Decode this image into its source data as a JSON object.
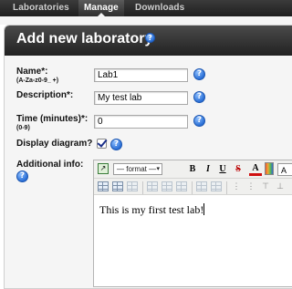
{
  "nav": {
    "tabs": [
      {
        "label": "Laboratories"
      },
      {
        "label": "Manage"
      },
      {
        "label": "Downloads"
      }
    ]
  },
  "panel": {
    "title": "Add new laboratory",
    "help_glyph": "?"
  },
  "form": {
    "name": {
      "label": "Name*:",
      "hint": "(A-Za-z0-9_ +)",
      "value": "Lab1"
    },
    "description": {
      "label": "Description*:",
      "value": "My test lab"
    },
    "time": {
      "label": "Time (minutes)*:",
      "hint": "(0-9)",
      "value": "0"
    },
    "display_diagram": {
      "label": "Display diagram?",
      "checked": true
    },
    "additional_info": {
      "label": "Additional info:"
    }
  },
  "editor": {
    "format_select": "— format —",
    "bold": "B",
    "italic": "I",
    "underline": "U",
    "strike": "S",
    "font_color": "A",
    "font_size_partial": "A",
    "content": "This is my first test lab!"
  },
  "colors": {
    "help_icon": "#2a6fd6",
    "header_dark": "#222222",
    "check": "#1a2f8a"
  }
}
